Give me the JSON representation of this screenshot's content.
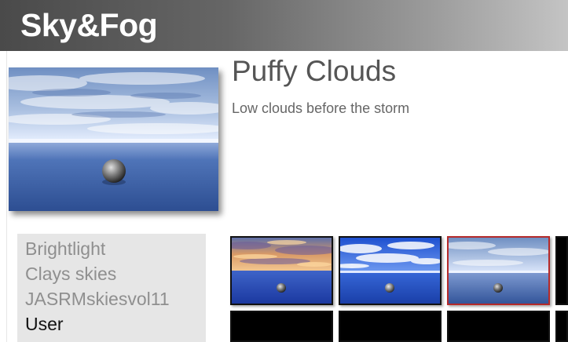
{
  "app": {
    "title": "Sky&Fog"
  },
  "preset": {
    "name": "Puffy Clouds",
    "description": "Low clouds before the storm"
  },
  "folders": [
    {
      "label": "Brightlight",
      "selected": false
    },
    {
      "label": "Clays skies",
      "selected": false
    },
    {
      "label": "JASRMskiesvol11",
      "selected": false
    },
    {
      "label": "User",
      "selected": true
    }
  ],
  "thumbnails": [
    {
      "sky": "sunset-clouds",
      "selected": false
    },
    {
      "sky": "bright-blue-clouds",
      "selected": false
    },
    {
      "sky": "puffy-clouds",
      "selected": true
    },
    {
      "sky": "empty",
      "selected": false
    }
  ],
  "colors": {
    "selection_border": "#b52a2a",
    "header_start": "#4a4a4a",
    "header_end": "#c4c4c4"
  }
}
